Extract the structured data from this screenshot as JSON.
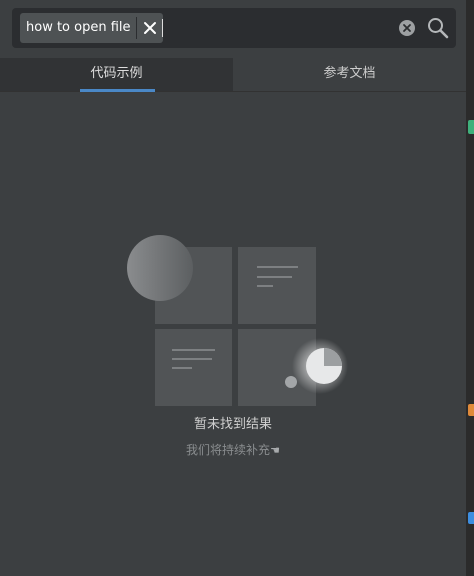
{
  "search": {
    "query_tag": "how to open file",
    "placeholder": ""
  },
  "tabs": [
    {
      "label": "代码示例",
      "active": true
    },
    {
      "label": "参考文档",
      "active": false
    }
  ],
  "empty_state": {
    "title": "暂未找到结果",
    "subtitle": "我们将持续补充",
    "subtitle_icon": "hand-pointing-icon"
  },
  "icons": {
    "tag_remove": "close-icon",
    "clear": "clear-circle-icon",
    "search": "search-icon"
  },
  "colors": {
    "background": "#3c3f41",
    "search_field": "#2b2d30",
    "tag": "#4e5254",
    "active_tab": "#313335",
    "tab_accent": "#4a88c7",
    "edge_green": "#3fb17c",
    "edge_orange": "#e08a3a",
    "edge_blue": "#3d8ee0"
  }
}
